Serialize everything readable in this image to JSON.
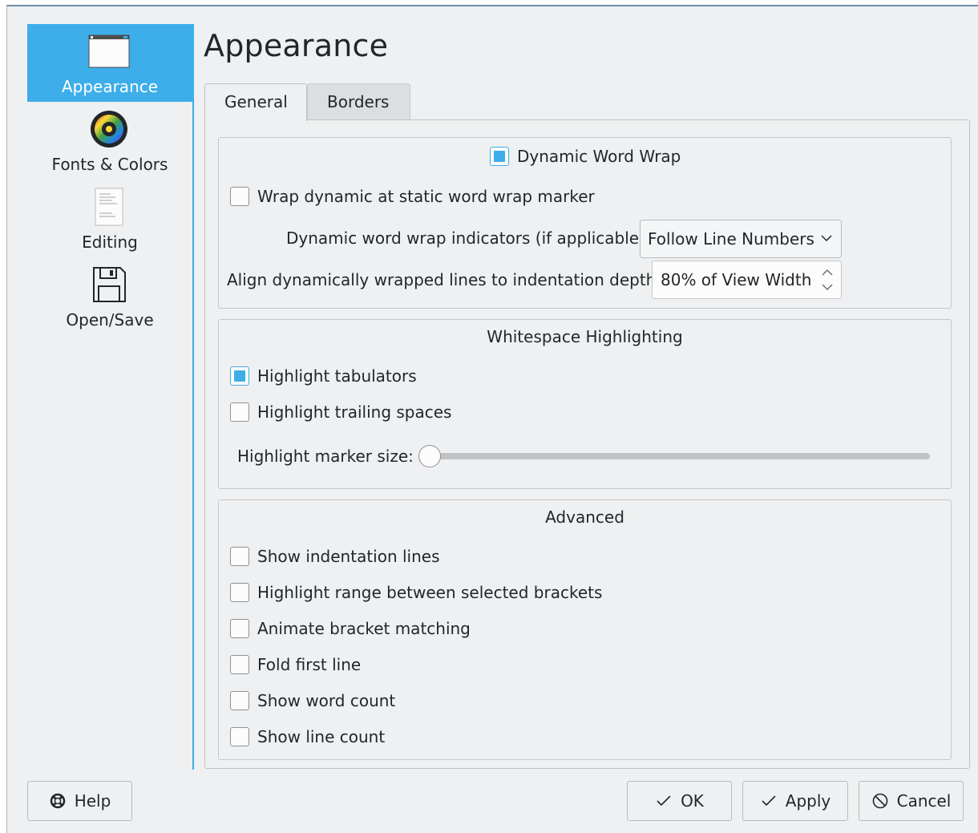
{
  "sidebar": {
    "items": [
      {
        "label": "Appearance",
        "icon": "window-icon",
        "active": true
      },
      {
        "label": "Fonts & Colors",
        "icon": "color-wheel-icon",
        "active": false
      },
      {
        "label": "Editing",
        "icon": "document-icon",
        "active": false
      },
      {
        "label": "Open/Save",
        "icon": "floppy-disk-icon",
        "active": false
      }
    ]
  },
  "header": {
    "title": "Appearance"
  },
  "tabs": [
    {
      "label": "General",
      "active": true
    },
    {
      "label": "Borders",
      "active": false
    }
  ],
  "dynamic_wrap": {
    "title": "Dynamic Word Wrap",
    "title_checked": true,
    "wrap_static_label": "Wrap dynamic at static word wrap marker",
    "wrap_static_checked": false,
    "indicators_label": "Dynamic word wrap indicators (if applicable):",
    "indicators_value": "Follow Line Numbers",
    "align_label": "Align dynamically wrapped lines to indentation depth:",
    "align_value": "80% of View Width"
  },
  "whitespace": {
    "title": "Whitespace Highlighting",
    "tabulators_label": "Highlight tabulators",
    "tabulators_checked": true,
    "trailing_label": "Highlight trailing spaces",
    "trailing_checked": false,
    "marker_size_label": "Highlight marker size:",
    "marker_size_fraction": 0.0
  },
  "advanced": {
    "title": "Advanced",
    "options": [
      {
        "label": "Show indentation lines",
        "checked": false
      },
      {
        "label": "Highlight range between selected brackets",
        "checked": false
      },
      {
        "label": "Animate bracket matching",
        "checked": false
      },
      {
        "label": "Fold first line",
        "checked": false
      },
      {
        "label": "Show word count",
        "checked": false
      },
      {
        "label": "Show line count",
        "checked": false
      }
    ]
  },
  "buttons": {
    "help": "Help",
    "ok": "OK",
    "apply": "Apply",
    "cancel": "Cancel"
  },
  "colors": {
    "accent": "#3daee9",
    "background": "#eff0f1",
    "text": "#232629"
  }
}
